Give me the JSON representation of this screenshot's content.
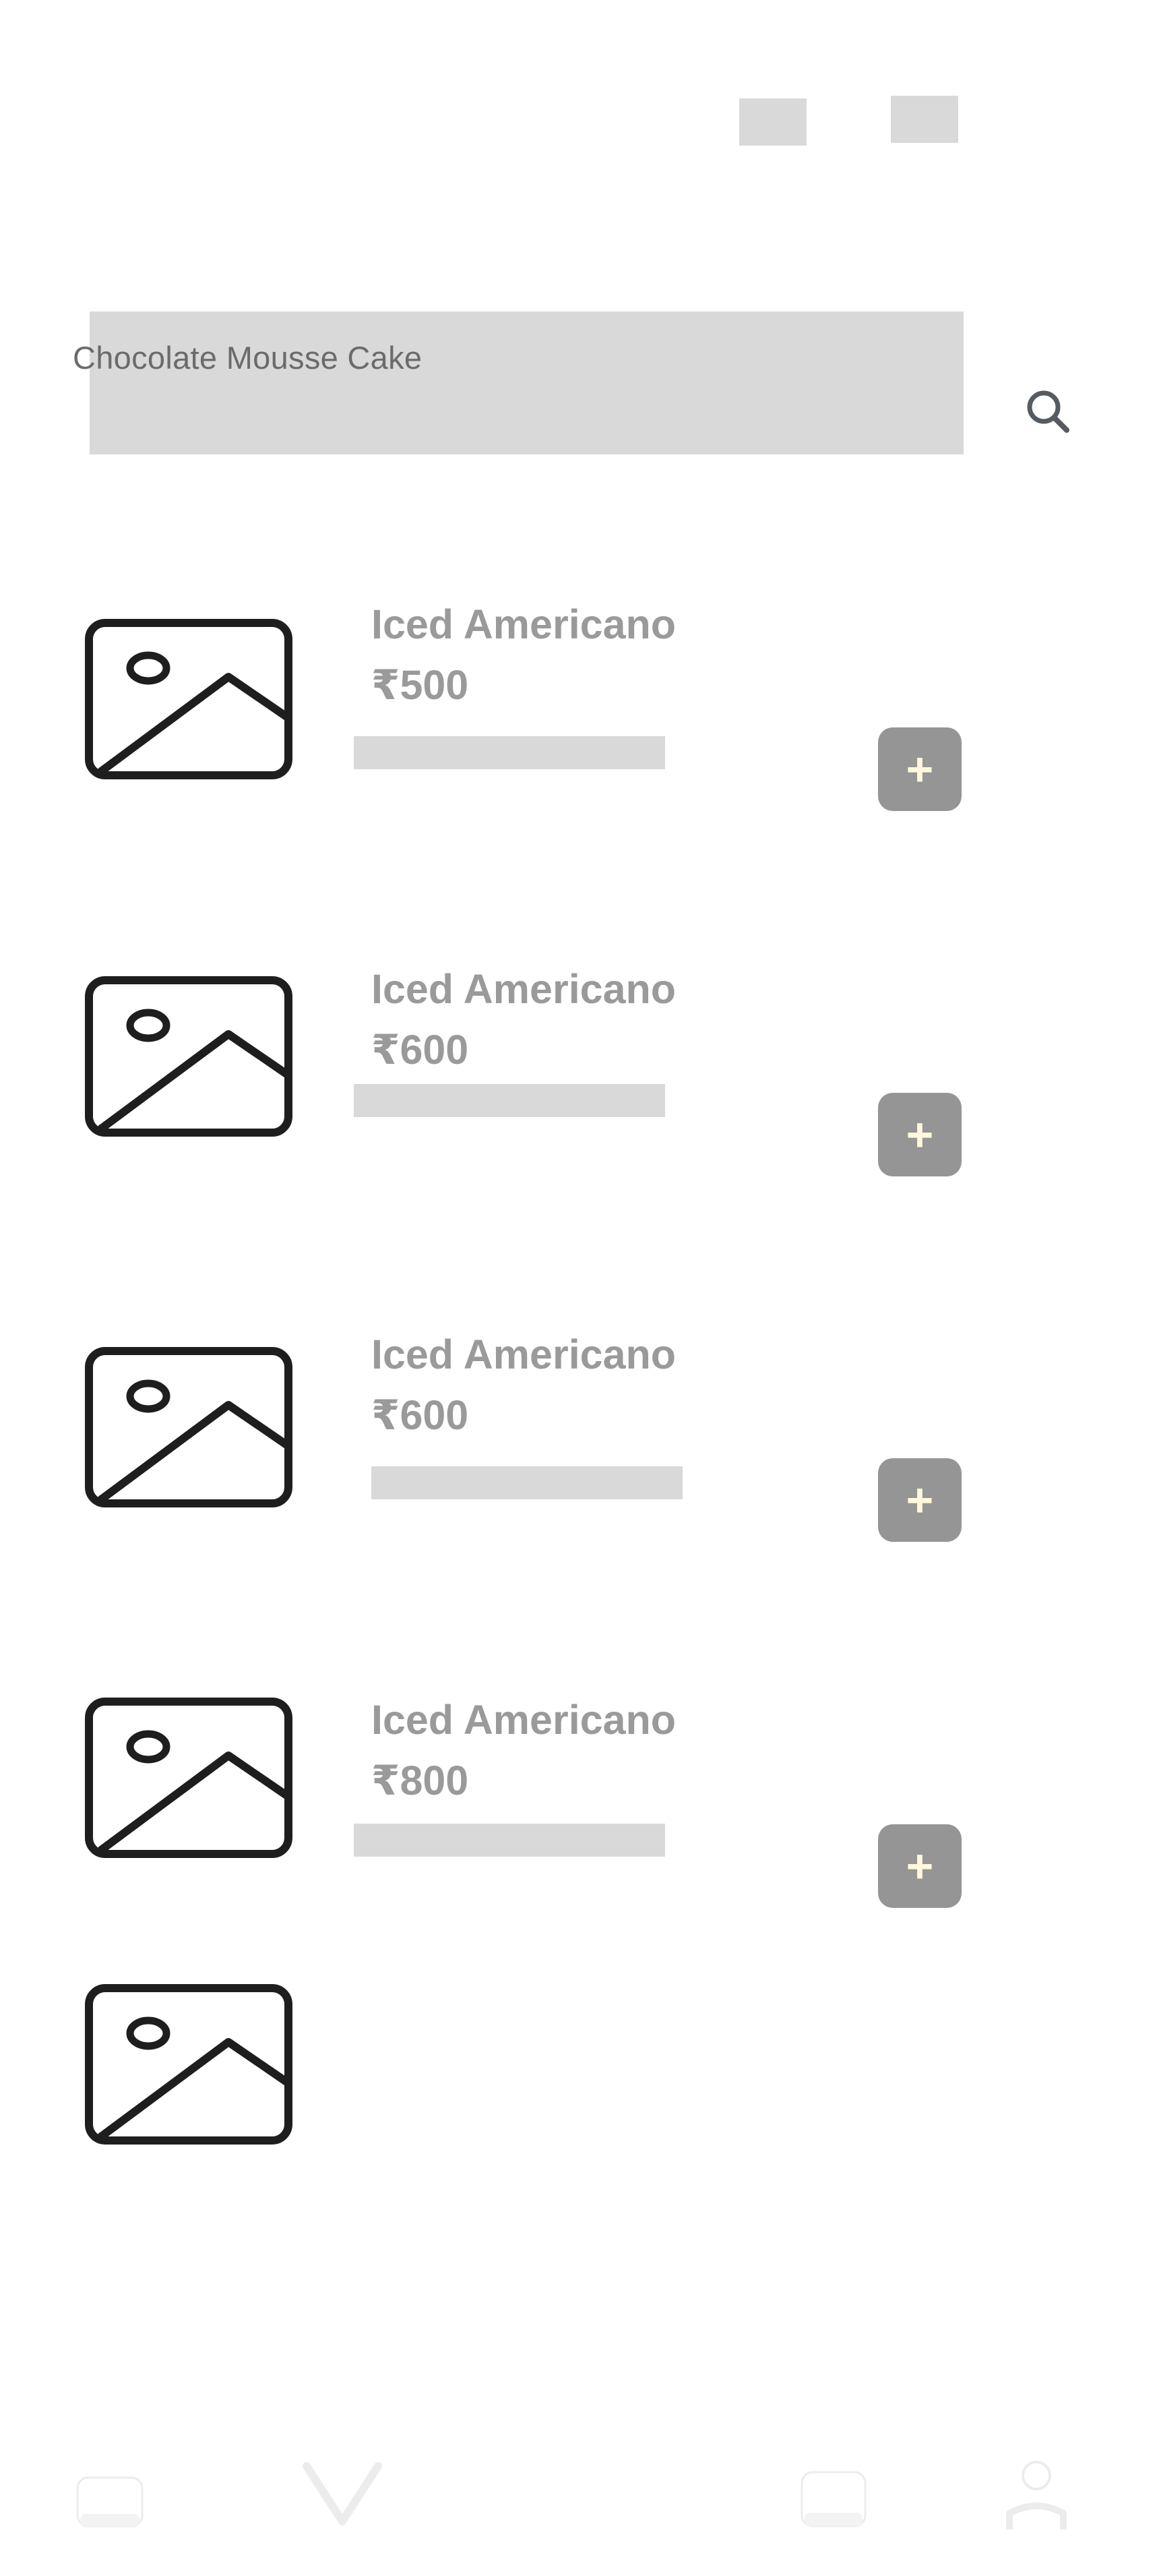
{
  "search": {
    "value": "Chocolate Mousse Cake"
  },
  "icons": {
    "search": "search-icon",
    "product_image": "image-placeholder-icon",
    "add": "plus-icon",
    "nav_home": "home-icon",
    "nav_favorites": "heart-icon",
    "nav_cart": "cart-icon",
    "nav_profile": "profile-icon"
  },
  "products": [
    {
      "name": "Iced Americano",
      "price": "₹500",
      "add_label": "+"
    },
    {
      "name": "Iced Americano",
      "price": "₹600",
      "add_label": "+"
    },
    {
      "name": "Iced Americano",
      "price": "₹600",
      "add_label": "+"
    },
    {
      "name": "Iced Americano",
      "price": "₹800",
      "add_label": "+"
    }
  ],
  "colors": {
    "placeholder": "#d9d9d9",
    "add_button": "#959595",
    "add_glyph": "#fff8dc",
    "text_muted": "#9a9a9a"
  }
}
